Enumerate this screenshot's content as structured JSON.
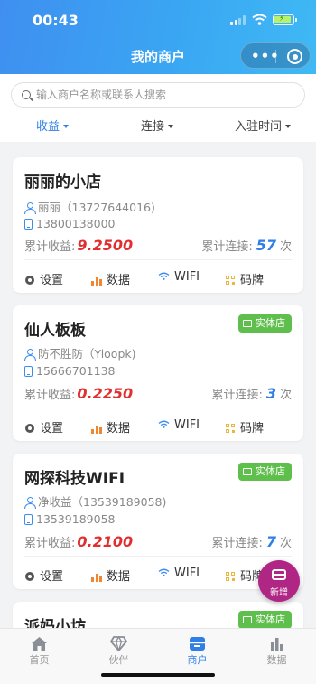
{
  "status_bar": {
    "time": "00:43"
  },
  "nav": {
    "title": "我的商户"
  },
  "search": {
    "placeholder": "输入商户名称或联系人搜索"
  },
  "sort_tabs": [
    {
      "label": "收益",
      "active": true
    },
    {
      "label": "连接",
      "active": false
    },
    {
      "label": "入驻时间",
      "active": false
    }
  ],
  "merchants": [
    {
      "name": "丽丽的小店",
      "badge": "",
      "contact": "丽丽（13727644016)",
      "phone": "13800138000",
      "earnings_label": "累计收益:",
      "earnings": "9.2500",
      "connections_label": "累计连接:",
      "connections": "57",
      "connections_unit": "次"
    },
    {
      "name": "仙人板板",
      "badge": "实体店",
      "contact": "防不胜防（Yioopk)",
      "phone": "15666701138",
      "earnings_label": "累计收益:",
      "earnings": "0.2250",
      "connections_label": "累计连接:",
      "connections": "3",
      "connections_unit": "次"
    },
    {
      "name": "网探科技WIFI",
      "badge": "实体店",
      "contact": "净收益（13539189058)",
      "phone": "13539189058",
      "earnings_label": "累计收益:",
      "earnings": "0.2100",
      "connections_label": "累计连接:",
      "connections": "7",
      "connections_unit": "次"
    },
    {
      "name": "派妈小坊",
      "badge": "实体店"
    }
  ],
  "card_actions": {
    "settings": "设置",
    "data": "数据",
    "wifi": "WIFI",
    "qrcode": "码牌"
  },
  "fab": {
    "label": "新增"
  },
  "tabbar": [
    {
      "label": "首页",
      "icon": "home-icon",
      "active": false
    },
    {
      "label": "伙伴",
      "icon": "diamond-icon",
      "active": false
    },
    {
      "label": "商户",
      "icon": "shop-icon",
      "active": true
    },
    {
      "label": "数据",
      "icon": "bar-chart-icon",
      "active": false
    }
  ],
  "colors": {
    "header_gradient_start": "#3f8ff0",
    "header_gradient_end": "#3fb9f4",
    "accent_blue": "#2f7fe6",
    "earnings_red": "#e12e2e",
    "badge_green": "#5fbf4d",
    "fab_magenta": "#b02685"
  }
}
